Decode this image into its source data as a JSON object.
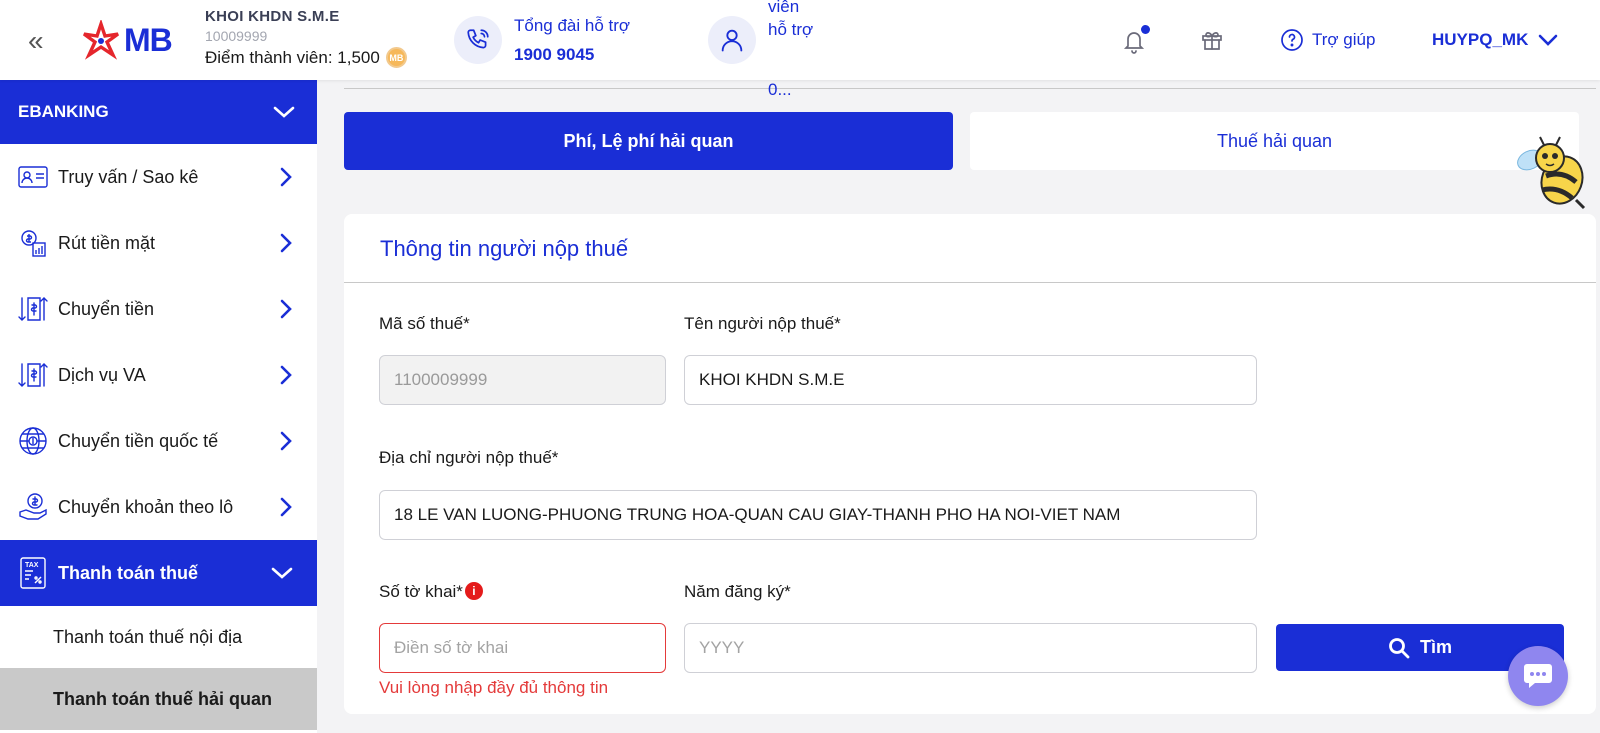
{
  "header": {
    "logo_text": "MB",
    "company_name": "KHOI KHDN S.M.E",
    "company_id": "10009999",
    "points_label": "Điểm thành viên: 1,500",
    "coin_label": "MB",
    "support_label": "Tổng đài hỗ trợ",
    "support_phone": "1900 9045",
    "member_label": "viên hỗ trợ",
    "member_more": "0...",
    "help_label": "Trợ giúp",
    "username": "HUYPQ_MK"
  },
  "sidebar": {
    "section_title": "EBANKING",
    "items": [
      {
        "label": "Truy vấn / Sao kê",
        "icon": "statement-icon"
      },
      {
        "label": "Rút tiền mặt",
        "icon": "cash-withdraw-icon"
      },
      {
        "label": "Chuyển tiền",
        "icon": "transfer-icon"
      },
      {
        "label": "Dịch vụ VA",
        "icon": "va-service-icon"
      },
      {
        "label": "Chuyển tiền quốc tế",
        "icon": "globe-transfer-icon"
      },
      {
        "label": "Chuyển khoản theo lô",
        "icon": "batch-transfer-icon"
      }
    ],
    "active_item": {
      "label": "Thanh toán thuế",
      "icon": "tax-icon"
    },
    "sub_items": [
      {
        "label": "Thanh toán thuế nội địa"
      },
      {
        "label": "Thanh toán thuế hải quan"
      }
    ]
  },
  "tabs": {
    "active": "Phí, Lệ phí hải quan",
    "inactive": "Thuế hải quan"
  },
  "form": {
    "title": "Thông tin người nộp thuế",
    "tax_code_label": "Mã số thuế*",
    "tax_code_value": "1100009999",
    "taxpayer_name_label": "Tên người nộp thuế*",
    "taxpayer_name_value": "KHOI KHDN S.M.E",
    "address_label": "Địa chỉ người nộp thuế*",
    "address_value": "18 LE VAN LUONG-PHUONG TRUNG HOA-QUAN CAU GIAY-THANH PHO HA NOI-VIET NAM",
    "declaration_label": "Số tờ khai*",
    "declaration_placeholder": "Điền số tờ khai",
    "declaration_error": "Vui lòng nhập đầy đủ thông tin",
    "year_label": "Năm đăng ký*",
    "year_placeholder": "YYYY",
    "search_button": "Tìm"
  },
  "colors": {
    "brand": "#1a2ed6",
    "error": "#e43a3a",
    "chat": "#8f86ef"
  }
}
